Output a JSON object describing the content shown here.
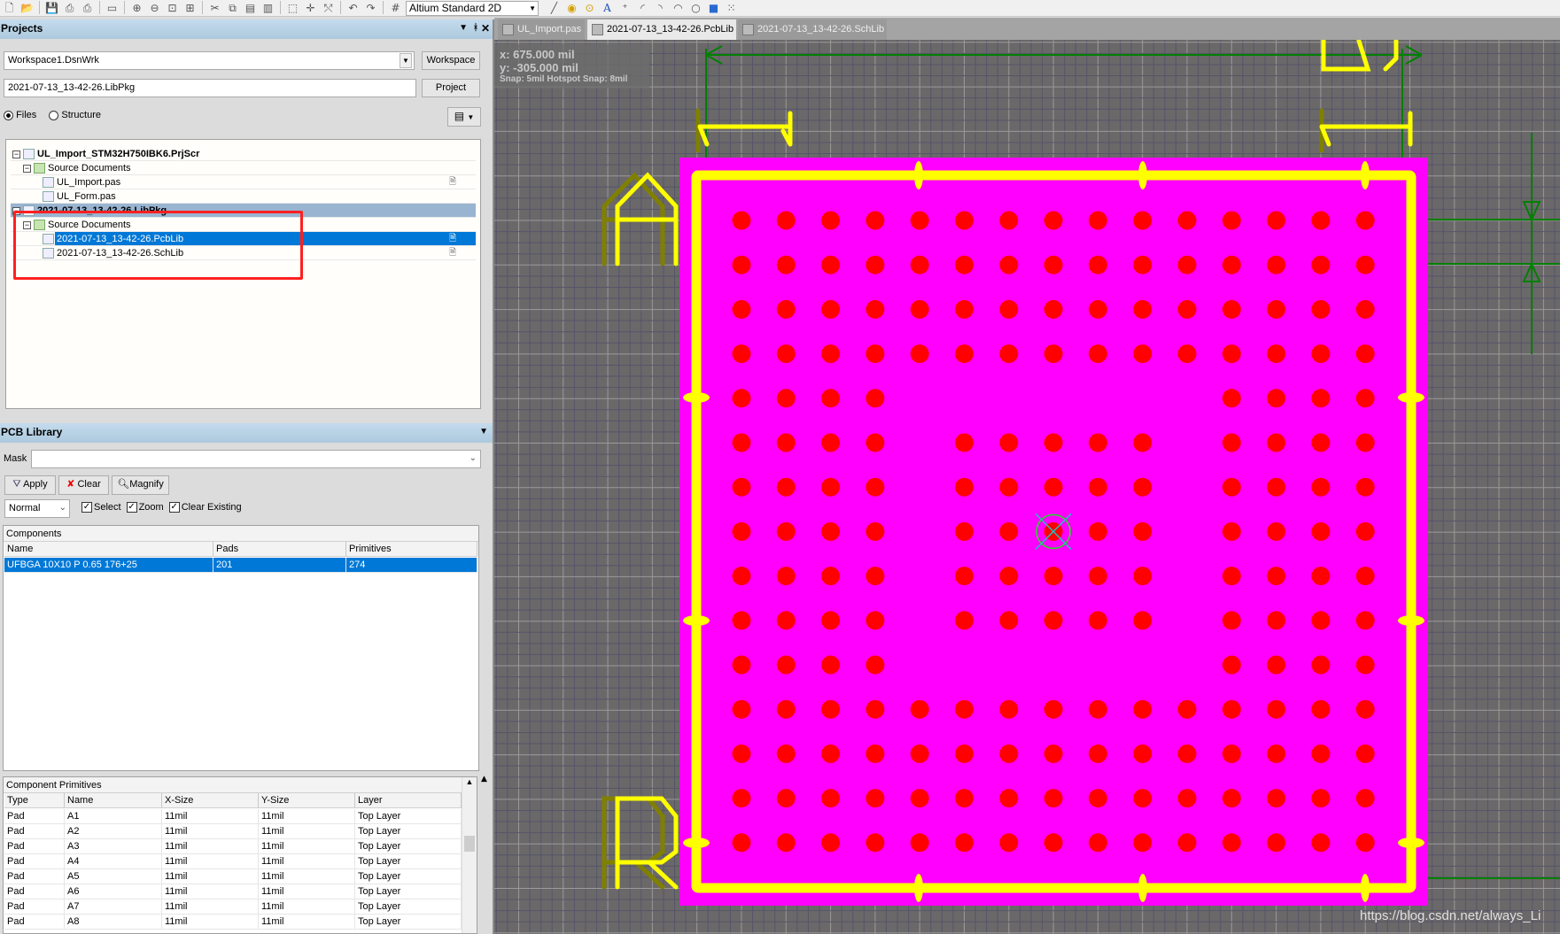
{
  "toolbar": {
    "icons": [
      "new-file-icon",
      "open-icon",
      "save-icon",
      "print-icon",
      "print-preview-icon",
      "open-doc-icon",
      "zoom-in-icon",
      "zoom-out-icon",
      "zoom-fit-icon",
      "zoom-area-icon",
      "cut-icon",
      "copy-icon",
      "paste-icon",
      "rubber-stamp-icon",
      "select-rect-icon",
      "move-icon",
      "deselect-icon",
      "undo-icon",
      "redo-icon",
      "grid-icon"
    ],
    "view_mode": "Altium Standard 2D",
    "right_icons": [
      "line-icon",
      "pad-icon",
      "via-icon",
      "string-icon",
      "coordinate-icon",
      "arc-center-icon",
      "arc-edge-icon",
      "arc-any-icon",
      "full-circle-icon",
      "fill-icon",
      "array-paste-icon"
    ]
  },
  "projects": {
    "title": "Projects",
    "workspace": "Workspace1.DsnWrk",
    "workspace_btn": "Workspace",
    "project": "2021-07-13_13-42-26.LibPkg",
    "project_btn": "Project",
    "view_files": "Files",
    "view_structure": "Structure",
    "selected_view": "Files",
    "tree": [
      {
        "label": "UL_Import_STM32H750IBK6.PrjScr",
        "level": 0,
        "bold": true,
        "expander": true
      },
      {
        "label": "Source Documents",
        "level": 1,
        "folder": true,
        "expander": true
      },
      {
        "label": "UL_Import.pas",
        "level": 2,
        "doc": true
      },
      {
        "label": "UL_Form.pas",
        "level": 2
      },
      {
        "label": "2021-07-13_13-42-26.LibPkg",
        "level": 0,
        "bold": true,
        "expander": true,
        "highlight": true
      },
      {
        "label": "Source Documents",
        "level": 1,
        "folder": true,
        "expander": true
      },
      {
        "label": "2021-07-13_13-42-26.PcbLib",
        "level": 2,
        "doc": true,
        "selected": true
      },
      {
        "label": "2021-07-13_13-42-26.SchLib",
        "level": 2,
        "doc": true
      }
    ]
  },
  "pcblib": {
    "title": "PCB Library",
    "mask_label": "Mask",
    "mask_value": "",
    "apply": "Apply",
    "clear": "Clear",
    "magnify": "Magnify",
    "mode": "Normal",
    "select": "Select",
    "zoom": "Zoom",
    "clear_existing": "Clear Existing",
    "components_title": "Components",
    "components_cols": [
      "Name",
      "Pads",
      "Primitives"
    ],
    "components": [
      [
        "UFBGA 10X10 P 0.65 176+25",
        "201",
        "274"
      ]
    ],
    "primitives_title": "Component Primitives",
    "primitives_cols": [
      "Type",
      "Name",
      "X-Size",
      "Y-Size",
      "Layer"
    ],
    "primitives": [
      [
        "Pad",
        "A1",
        "11mil",
        "11mil",
        "Top Layer"
      ],
      [
        "Pad",
        "A2",
        "11mil",
        "11mil",
        "Top Layer"
      ],
      [
        "Pad",
        "A3",
        "11mil",
        "11mil",
        "Top Layer"
      ],
      [
        "Pad",
        "A4",
        "11mil",
        "11mil",
        "Top Layer"
      ],
      [
        "Pad",
        "A5",
        "11mil",
        "11mil",
        "Top Layer"
      ],
      [
        "Pad",
        "A6",
        "11mil",
        "11mil",
        "Top Layer"
      ],
      [
        "Pad",
        "A7",
        "11mil",
        "11mil",
        "Top Layer"
      ],
      [
        "Pad",
        "A8",
        "11mil",
        "11mil",
        "Top Layer"
      ]
    ]
  },
  "tabs": [
    {
      "label": "UL_Import.pas",
      "active": false
    },
    {
      "label": "2021-07-13_13-42-26.PcbLib",
      "active": true
    },
    {
      "label": "2021-07-13_13-42-26.SchLib",
      "active": false
    }
  ],
  "hud": {
    "x": "x:   675.000  mil",
    "y": "y:  -305.000  mil",
    "snap": "Snap: 5mil Hotspot Snap: 8mil"
  },
  "footprint": {
    "pad_rows": [
      "111111111111111",
      "111111111111111",
      "111111111111111",
      "111111111111111",
      "111100000001111",
      "111101111101111",
      "111101111101111",
      "111101111101111",
      "111101111101111",
      "111101111101111",
      "111100000001111",
      "111111111111111",
      "111111111111111",
      "111111111111111",
      "111111111111111"
    ],
    "colors": {
      "body": "#ff00ff",
      "pad": "#ff0000",
      "silk": "#ffff00",
      "silk_shadow": "#808000",
      "dimension": "#008000",
      "grid_bg": "#6b6869"
    }
  },
  "watermark": "https://blog.csdn.net/always_Li"
}
